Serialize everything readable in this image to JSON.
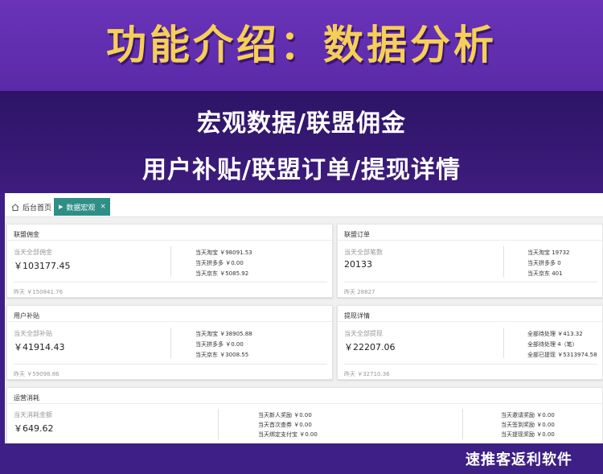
{
  "banner": {
    "title": "功能介绍：数据分析",
    "line1": "宏观数据/联盟佣金",
    "line2": "用户补贴/联盟订单/提现详情"
  },
  "tabs": {
    "home": "后台首页",
    "active": "数据宏观",
    "close": "×"
  },
  "cards": {
    "commission": {
      "title": "联盟佣金",
      "label": "当天全部佣金",
      "value": "￥103177.45",
      "stats": [
        "当天淘宝 ￥98091.53",
        "当天拼多多 ￥0.00",
        "当天京东 ￥5085.92"
      ],
      "yesterday": "昨天 ￥150841.76"
    },
    "orders": {
      "title": "联盟订单",
      "label": "当天全部笔数",
      "value": "20133",
      "stats": [
        "当天淘宝 19732",
        "当天拼多多 0",
        "当天京东 401"
      ],
      "yesterday": "昨天 28827"
    },
    "subsidy": {
      "title": "用户补贴",
      "label": "当天全部补贴",
      "value": "￥41914.43",
      "stats": [
        "当天淘宝 ￥38905.88",
        "当天拼多多 ￥0.00",
        "当天京东 ￥3008.55"
      ],
      "yesterday": "昨天 ￥59098.86"
    },
    "withdraw": {
      "title": "提现详情",
      "label": "当天全部提现",
      "value": "￥22207.06",
      "stats": [
        "全部待处理 ￥413.32",
        "全部待处理 4（笔）",
        "全部已提现 ￥5313974.58"
      ],
      "yesterday": "昨天 ￥32710.36"
    },
    "operations": {
      "title": "运营消耗",
      "label": "当天消耗金额",
      "value": "￥649.62",
      "stats_mid": [
        "当天新人奖励 ￥0.00",
        "当天首次查券 ￥0.00",
        "当天绑定支付宝 ￥0.00"
      ],
      "stats_right": [
        "当天邀请奖励 ￥0.00",
        "当天签到奖励 ￥0.00",
        "当天提现奖励 ￥0.00"
      ]
    }
  },
  "footer": {
    "brand": "速推客返利软件"
  },
  "colors": {
    "title_gold": "#f5cf57",
    "tab_teal": "#2f8f86",
    "banner_purple": "#5a2aa8"
  }
}
